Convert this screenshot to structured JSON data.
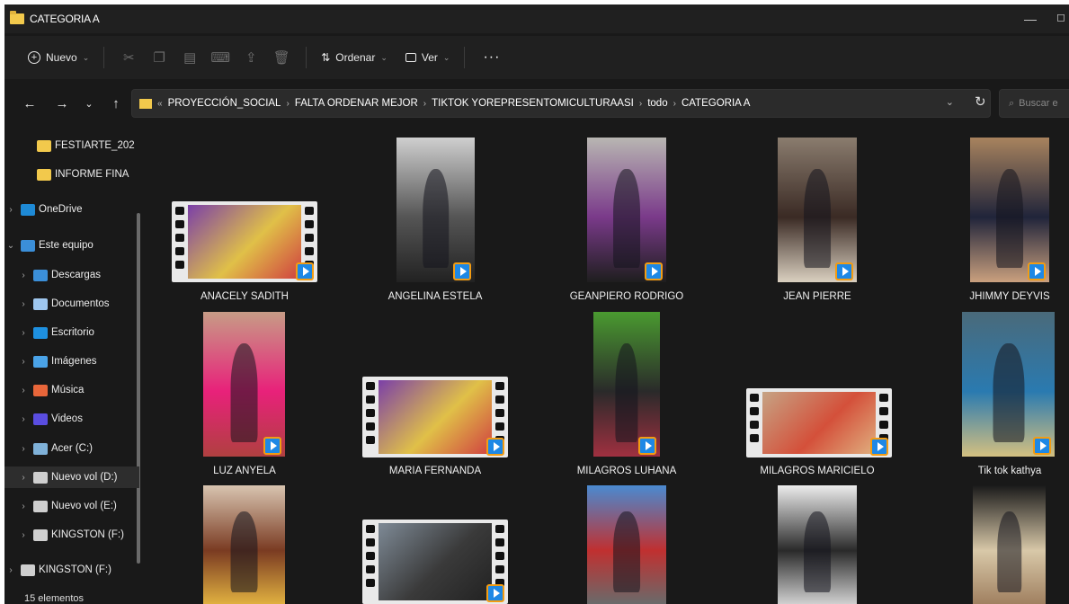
{
  "window": {
    "title": "CATEGORIA A"
  },
  "toolbar": {
    "new_label": "Nuevo",
    "sort_label": "Ordenar",
    "view_label": "Ver",
    "more_label": "···"
  },
  "address": {
    "crumbs": [
      "PROYECCIÓN_SOCIAL",
      "FALTA ORDENAR MEJOR",
      "TIKTOK YOREPRESENTOMICULTURAASI",
      "todo",
      "CATEGORIA A"
    ],
    "search_placeholder": "Buscar e"
  },
  "sidebar": {
    "items": [
      {
        "label": "FESTIARTE_202",
        "icon": "folder-icon"
      },
      {
        "label": "INFORME FINA",
        "icon": "folder-icon"
      },
      {
        "label": "OneDrive",
        "icon": "cloud-icon"
      },
      {
        "label": "Este equipo",
        "icon": "computer-icon"
      },
      {
        "label": "Descargas",
        "icon": "download-icon"
      },
      {
        "label": "Documentos",
        "icon": "document-icon"
      },
      {
        "label": "Escritorio",
        "icon": "desktop-icon"
      },
      {
        "label": "Imágenes",
        "icon": "pictures-icon"
      },
      {
        "label": "Música",
        "icon": "music-icon"
      },
      {
        "label": "Videos",
        "icon": "video-icon"
      },
      {
        "label": "Acer (C:)",
        "icon": "drive-icon"
      },
      {
        "label": "Nuevo vol (D:)",
        "icon": "drive-icon"
      },
      {
        "label": "Nuevo vol (E:)",
        "icon": "drive-icon"
      },
      {
        "label": "KINGSTON (F:)",
        "icon": "drive-icon"
      },
      {
        "label": "KINGSTON (F:)",
        "icon": "drive-icon"
      }
    ]
  },
  "files": [
    {
      "name": "ANACELY SADITH",
      "kind": "filmstrip"
    },
    {
      "name": "ANGELINA ESTELA",
      "kind": "portrait"
    },
    {
      "name": "GEANPIERO RODRIGO",
      "kind": "portrait"
    },
    {
      "name": "JEAN PIERRE",
      "kind": "portrait"
    },
    {
      "name": "JHIMMY DEYVIS",
      "kind": "portrait"
    },
    {
      "name": "LUZ ANYELA",
      "kind": "portrait"
    },
    {
      "name": "MARIA FERNANDA",
      "kind": "filmstrip"
    },
    {
      "name": "MILAGROS LUHANA",
      "kind": "portrait"
    },
    {
      "name": "MILAGROS MARICIELO",
      "kind": "filmstrip"
    },
    {
      "name": "Tik tok kathya",
      "kind": "portrait"
    },
    {
      "name": "",
      "kind": "portrait"
    },
    {
      "name": "",
      "kind": "filmstrip"
    },
    {
      "name": "",
      "kind": "portrait"
    },
    {
      "name": "",
      "kind": "portrait"
    },
    {
      "name": "",
      "kind": "portrait"
    }
  ],
  "status": {
    "count": "15 elementos"
  },
  "colors": {
    "folder": "#f2c94c",
    "play": "#1e88e5",
    "play_border": "#f39c12",
    "background": "#191919"
  }
}
